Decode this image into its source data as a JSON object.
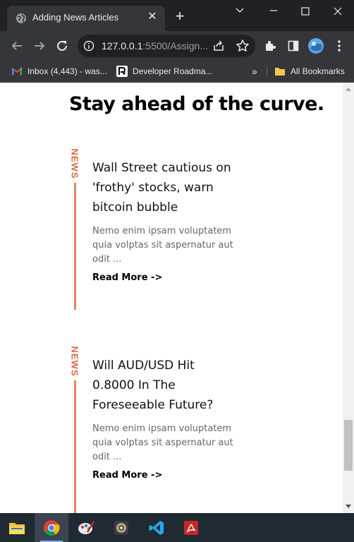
{
  "browser": {
    "tab": {
      "title": "Adding News Articles",
      "close_glyph": "✕",
      "favicon": "globe-icon"
    },
    "new_tab_glyph": "+",
    "window_controls": [
      "chevron-down-icon",
      "minimize-icon",
      "maximize-icon",
      "close-icon"
    ],
    "url": {
      "host": "127.0.0.1",
      "rest": ":5500/Assign..."
    },
    "toolbar_icons": [
      "back-icon",
      "forward-icon",
      "reload-icon",
      "share-icon",
      "star-icon",
      "extensions-icon",
      "sidepanel-icon",
      "profile-avatar",
      "menu-icon"
    ],
    "bookmarks": [
      {
        "label": "Inbox (4,443) - was...",
        "icon": "gmail-icon"
      },
      {
        "label": "Developer Roadma...",
        "icon": "roadmap-icon"
      }
    ],
    "bookmarks_overflow": "»",
    "all_bookmarks": {
      "label": "All Bookmarks",
      "icon": "folder-icon"
    }
  },
  "page": {
    "heading": "Stay ahead of the curve.",
    "articles": [
      {
        "tag": "NEWS",
        "title": "Wall Street cautious on 'frothy' stocks, warn bitcoin bubble",
        "body": "Nemo enim ipsam voluptatem quia volptas sit aspernatur aut odit ...",
        "read_more": "Read More ->"
      },
      {
        "tag": "NEWS",
        "title": "Will AUD/USD Hit 0.8000 In The Foreseeable Future?",
        "body": "Nemo enim ipsam voluptatem quia volptas sit aspernatur aut odit ...",
        "read_more": "Read More ->"
      }
    ]
  },
  "taskbar": {
    "apps": [
      "file-explorer-icon",
      "chrome-icon",
      "paint-icon",
      "app-icon",
      "vscode-icon",
      "pdf-reader-icon"
    ],
    "active_app": "chrome-icon"
  },
  "colors": {
    "accent": "#d66b45",
    "accent_line": "#e2855f",
    "chrome_dark": "#202124",
    "chrome_toolbar": "#35363a",
    "taskbar": "#1f2a33"
  }
}
